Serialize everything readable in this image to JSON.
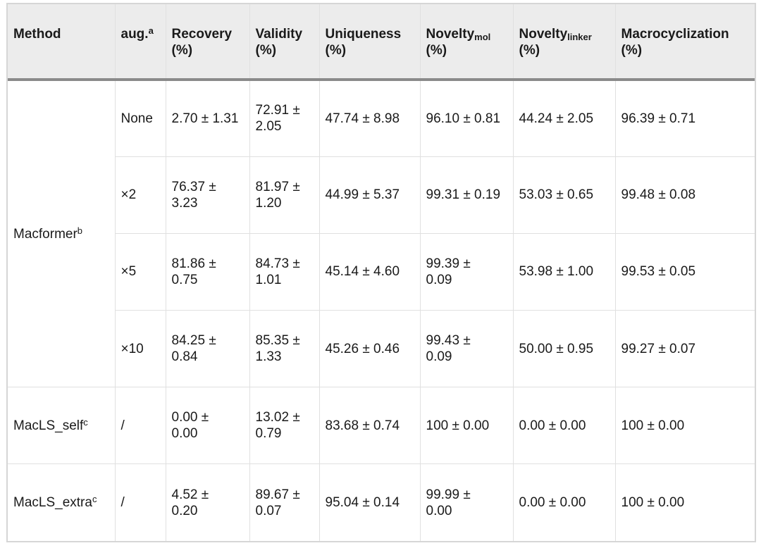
{
  "table": {
    "headers": [
      {
        "main": "Method",
        "sub": "",
        "sup": "",
        "line2": ""
      },
      {
        "main": "aug.",
        "sub": "",
        "sup": "a",
        "line2": ""
      },
      {
        "main": "Recovery",
        "sub": "",
        "sup": "",
        "line2": "(%)"
      },
      {
        "main": "Validity",
        "sub": "",
        "sup": "",
        "line2": "(%)"
      },
      {
        "main": "Uniqueness",
        "sub": "",
        "sup": "",
        "line2": "(%)"
      },
      {
        "main": "Novelty",
        "sub": "mol",
        "sup": "",
        "line2": "(%)"
      },
      {
        "main": "Novelty",
        "sub": "linker",
        "sup": "",
        "line2": "(%)"
      },
      {
        "main": "Macrocyclization",
        "sub": "",
        "sup": "",
        "line2": "(%)"
      }
    ],
    "methods": [
      {
        "name": "Macformer",
        "sup": "b"
      },
      {
        "name": "MacLS_self",
        "sup": "c"
      },
      {
        "name": "MacLS_extra",
        "sup": "c"
      }
    ],
    "rows": [
      {
        "aug": "None",
        "cells": [
          [
            "2.70 ± 1.31",
            ""
          ],
          [
            "72.91 ±",
            "2.05"
          ],
          [
            "47.74 ± 8.98",
            ""
          ],
          [
            "96.10 ± 0.81",
            ""
          ],
          [
            "44.24 ± 2.05",
            ""
          ],
          [
            "96.39 ± 0.71",
            ""
          ]
        ]
      },
      {
        "aug": "×2",
        "cells": [
          [
            "76.37 ±",
            "3.23"
          ],
          [
            "81.97 ±",
            "1.20"
          ],
          [
            "44.99 ± 5.37",
            ""
          ],
          [
            "99.31 ± 0.19",
            ""
          ],
          [
            "53.03 ± 0.65",
            ""
          ],
          [
            "99.48 ± 0.08",
            ""
          ]
        ]
      },
      {
        "aug": "×5",
        "cells": [
          [
            "81.86 ±",
            "0.75"
          ],
          [
            "84.73 ±",
            "1.01"
          ],
          [
            "45.14 ± 4.60",
            ""
          ],
          [
            "99.39 ±",
            "0.09"
          ],
          [
            "53.98 ± 1.00",
            ""
          ],
          [
            "99.53 ± 0.05",
            ""
          ]
        ]
      },
      {
        "aug": "×10",
        "cells": [
          [
            "84.25 ±",
            "0.84"
          ],
          [
            "85.35 ±",
            "1.33"
          ],
          [
            "45.26 ± 0.46",
            ""
          ],
          [
            "99.43 ±",
            "0.09"
          ],
          [
            "50.00 ± 0.95",
            ""
          ],
          [
            "99.27 ± 0.07",
            ""
          ]
        ]
      },
      {
        "aug": "/",
        "cells": [
          [
            "0.00 ±",
            "0.00"
          ],
          [
            "13.02 ±",
            "0.79"
          ],
          [
            "83.68 ± 0.74",
            ""
          ],
          [
            "100 ± 0.00",
            ""
          ],
          [
            "0.00 ± 0.00",
            ""
          ],
          [
            "100 ± 0.00",
            ""
          ]
        ]
      },
      {
        "aug": "/",
        "cells": [
          [
            "4.52 ±",
            "0.20"
          ],
          [
            "89.67 ±",
            "0.07"
          ],
          [
            "95.04 ± 0.14",
            ""
          ],
          [
            "99.99 ±",
            "0.00"
          ],
          [
            "0.00 ± 0.00",
            ""
          ],
          [
            "100 ± 0.00",
            ""
          ]
        ]
      }
    ]
  }
}
